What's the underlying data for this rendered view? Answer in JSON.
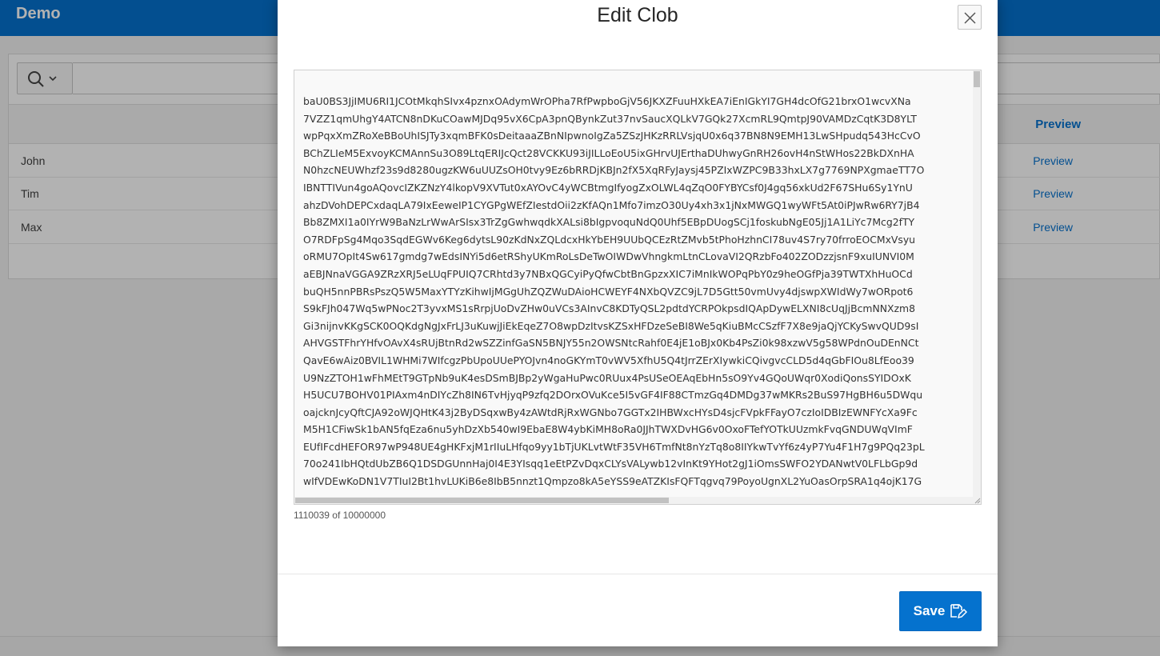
{
  "app": {
    "title": "Demo"
  },
  "report": {
    "preview_header": "Preview",
    "rows": [
      {
        "name": "John",
        "link": "Preview"
      },
      {
        "name": "Tim",
        "link": "Preview"
      },
      {
        "name": "Max",
        "link": "Preview"
      }
    ]
  },
  "dialog": {
    "title": "Edit Clob",
    "clob_lines": [
      "baU0BS3JjIMU6RI1JCOtMkqhSIvx4pznxOAdymWrOPha7RfPwpboGjV56JKXZFuuHXkEA7iEnIGkYI7GH4dcOfG21brxO1wcvXNa",
      "7VZZ1qmUhgY4ATCN8nDKuCOawMJDq95vX6CpA3pnQBynkZut37nvSaucXQLkV7GQk27XcmRL9QmtpJ90VAMDzCqtK3D8YLT",
      "wpPqxXmZRoXeBBoUhISJTy3xqmBFK0sDeitaaaZBnNIpwnoIgZa5ZSzJHKzRRLVsjqU0x6q37BN8N9EMH13LwSHpudq543HcCvO",
      "BChZLIeM5ExvoyKCMAnnSu3O89LtqERIJcQct28VCKKU93iJILLoEoU5ixGHrvUJErthaDUhwyGnRH26ovH4nStWHos22BkDXnHA",
      "N0hzcNEUWhzf23s9d8280ugzKW6uUUZsOH0tvy9Ez6bRRDjKBJn2fX5XqRFyJaysj45PZIxWZPC9B33hxLX7g7769NPXgmaeTT7O",
      "IBNTTIVun4goAQovcIZKZNzY4lkopV9XVTut0xAYOvC4yWCBtmgIfyogZxOLWL4qZqO0FYBYCsf0J4gq56xkUd2F67SHu6Sy1YnU",
      "ahzDVohDEPCxdaqLA79IxEeweIP1CYGPgWEfZIestdOii2zKfAQn1Mfo7imzO30Uy4xh3x1jNxMWGQ1wyWFt5At0iPJwRw6RY7jB4",
      "Bb8ZMXI1a0IYrW9BaNzLrWwArSIsx3TrZgGwhwqdkXALsi8bIgpvoquNdQ0Uhf5EBpDUogSCj1foskubNgE05Jj1A1LiYc7Mcg2fTY",
      "O7RDFpSg4Mqo3SqdEGWv6Keg6dytsL90zKdNxZQLdcxHkYbEH9UUbQCEzRtZMvb5tPhoHzhnCI78uv4S7ry70frroEOCMxVsyu",
      "oRMU7OpIt4Sw617gmdg7wEdsINYi5d6etRShyUKmRoLsDeTwOIWDwVhngkmLtnCLovaVI2QRzbFo402ZODzzjsnF9xuIUNVI0M",
      "aEBJNnaVGGA9ZRzXRJ5eLUqFPUIQ7CRhtd3y7NBxQGCyiPyQfwCbtBnGpzxXIC7iMnIkWOPqPbY0z9heOGfPja39TWTXhHuOCd",
      "buQH5nnPBRsPszQ5W5MaxYTYzKihwIjMGgUhZQZWuDAioHCWEYF4NXbQVZC9jL7D5Gtt50vmUvy4djswpXWIdWy7wORpot6",
      "S9kFJh047Wq5wPNoc2T3yvxMS1sRrpjUoDvZHw0uVCs3AInvC8KDTyQSL2pdtdYCRPOkpsdIQApDywELXNI8cUqJjBcmNNXzm8",
      "Gi3nijnvKKgSCK0OQKdgNgJxFrLJ3uKuwjJiEkEqeZ7O8wpDzItvsKZSxHFDzeSeBI8We5qKiuBMcCSzfF7X8e9jaQjYCKySwvQUD9sI",
      "AHVGSTFhrYHfvOAvX4sRUjBtnRd2wSZZinfGaSN5BNJY55n2OWSNtcRahf0E4jE1oBJx0Kb4PsZi0k98xzwV5g58WPdnOuDEnNCt",
      "QavE6wAiz0BVIL1WHMi7WIfcgzPbUpoUUePYOJvn4noGKYmT0vWV5XfhU5Q4tJrrZErXIywkiCQivgvcCLD5d4qGbFIOu8LfEoo39",
      "U9NzZTOH1wFhMEtT9GTpNb9uK4esDSmBJBp2yWgaHuPwc0RUux4PsUSeOEAqEbHn5sO9Yv4GQoUWqr0XodiQonsSYIDOxK",
      "H5UCU7BOHV01PIAxm4nDIYcZh8IN6TvHjyqP9zfq2DOrxOVuKce5I5vGF4IF88CTmzGq4DMDg37wMKRs2BuS97HgBH6u5DWqu",
      "oajcknJcyQftCJA92oWJQHtK43j2ByDSqxwBy4zAWtdRjRxWGNbo7GGTx2IHBWxcHYsD4sjcFVpkFFayO7czIoIDBIzEWNFYcXa9Fc",
      "M5H1CFiwSk1bAN5fqEza6nu5yhDzXb540wI9EbaE8W4ybKiMH8oRa0JJhTWXDvHG6v0OxoFTefYOTkUUzmkFvqGNDUWqVImF",
      "EUfIFcdHEFOR97wP948UE4gHKFxjM1rIIuLHfqo9yy1bTjUKLvtWtF35VH6TmfNt8nYzTq8o8IIYkwTvYf6z4yP7Yu4F1H7g9PQq23pL",
      "70o241IbHQtdUbZB6Q1DSDGUnnHaj0I4E3YIsqq1eEtPZvDqxCLYsVALywb12vInKt9YHot2gJ1iOmsSWFO2YDANwtV0LFLbGp9d",
      "wIfVDEwKoDN1V7TIuI2Bt1hvLUKiB6e8IbB5nnzt1Qmpzo8kA5eYSS9eATZKIsFQFTqgvq79PoyoUgnXL2YuOasOrpSRA1q4ojK17G"
    ],
    "counter": "1110039 of 10000000",
    "save_label": "Save"
  }
}
